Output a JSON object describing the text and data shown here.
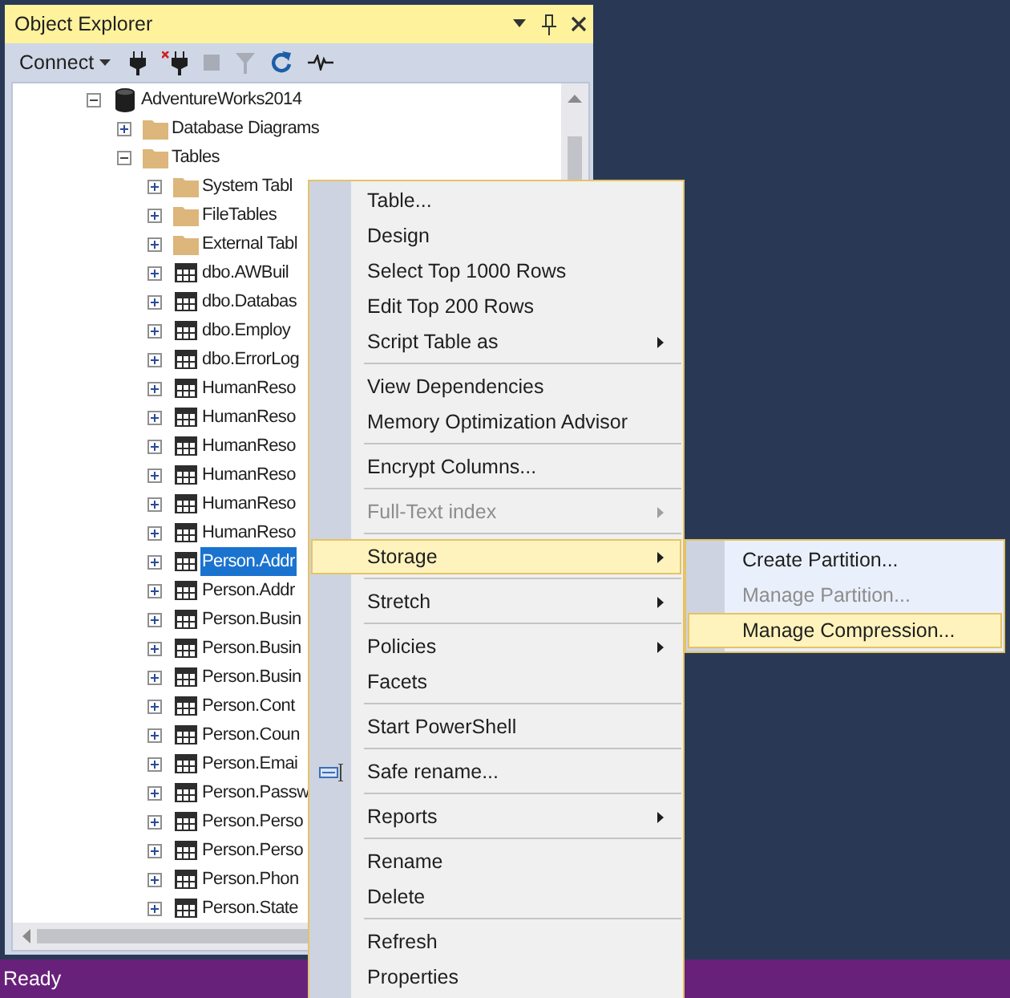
{
  "panel": {
    "title": "Object Explorer",
    "connect_label": "Connect"
  },
  "tree": [
    {
      "label": "AdventureWorks2014",
      "kind": "database",
      "expanded": true,
      "selected": false,
      "children": [
        {
          "label": "Database Diagrams",
          "kind": "folder",
          "expanded": false,
          "selected": false
        },
        {
          "label": "Tables",
          "kind": "folder",
          "expanded": true,
          "selected": false,
          "children": [
            {
              "label": "System Tabl",
              "kind": "folder",
              "expanded": false,
              "selected": false
            },
            {
              "label": "FileTables",
              "kind": "folder",
              "expanded": false,
              "selected": false
            },
            {
              "label": "External Tabl",
              "kind": "folder",
              "expanded": false,
              "selected": false
            },
            {
              "label": "dbo.AWBuil",
              "kind": "table",
              "expanded": false,
              "selected": false
            },
            {
              "label": "dbo.Databas",
              "kind": "table",
              "expanded": false,
              "selected": false
            },
            {
              "label": "dbo.Employ",
              "kind": "table",
              "expanded": false,
              "selected": false
            },
            {
              "label": "dbo.ErrorLog",
              "kind": "table",
              "expanded": false,
              "selected": false
            },
            {
              "label": "HumanReso",
              "kind": "table",
              "expanded": false,
              "selected": false
            },
            {
              "label": "HumanReso",
              "kind": "table",
              "expanded": false,
              "selected": false
            },
            {
              "label": "HumanReso",
              "kind": "table",
              "expanded": false,
              "selected": false
            },
            {
              "label": "HumanReso",
              "kind": "table",
              "expanded": false,
              "selected": false
            },
            {
              "label": "HumanReso",
              "kind": "table",
              "expanded": false,
              "selected": false
            },
            {
              "label": "HumanReso",
              "kind": "table",
              "expanded": false,
              "selected": false
            },
            {
              "label": "Person.Addr",
              "kind": "table",
              "expanded": false,
              "selected": true
            },
            {
              "label": "Person.Addr",
              "kind": "table",
              "expanded": false,
              "selected": false
            },
            {
              "label": "Person.Busin",
              "kind": "table",
              "expanded": false,
              "selected": false
            },
            {
              "label": "Person.Busin",
              "kind": "table",
              "expanded": false,
              "selected": false
            },
            {
              "label": "Person.Busin",
              "kind": "table",
              "expanded": false,
              "selected": false
            },
            {
              "label": "Person.Cont",
              "kind": "table",
              "expanded": false,
              "selected": false
            },
            {
              "label": "Person.Coun",
              "kind": "table",
              "expanded": false,
              "selected": false
            },
            {
              "label": "Person.Emai",
              "kind": "table",
              "expanded": false,
              "selected": false
            },
            {
              "label": "Person.Passw",
              "kind": "table",
              "expanded": false,
              "selected": false
            },
            {
              "label": "Person.Perso",
              "kind": "table",
              "expanded": false,
              "selected": false
            },
            {
              "label": "Person.Perso",
              "kind": "table",
              "expanded": false,
              "selected": false
            },
            {
              "label": "Person.Phon",
              "kind": "table",
              "expanded": false,
              "selected": false
            },
            {
              "label": "Person.State",
              "kind": "table",
              "expanded": false,
              "selected": false
            }
          ]
        }
      ]
    }
  ],
  "context_menu": {
    "items": [
      {
        "kind": "item",
        "label": "Table...",
        "submenu": false,
        "disabled": false,
        "selected": false
      },
      {
        "kind": "item",
        "label": "Design",
        "submenu": false,
        "disabled": false,
        "selected": false
      },
      {
        "kind": "item",
        "label": "Select Top 1000 Rows",
        "submenu": false,
        "disabled": false,
        "selected": false
      },
      {
        "kind": "item",
        "label": "Edit Top 200 Rows",
        "submenu": false,
        "disabled": false,
        "selected": false
      },
      {
        "kind": "item",
        "label": "Script Table as",
        "submenu": true,
        "disabled": false,
        "selected": false
      },
      {
        "kind": "separator"
      },
      {
        "kind": "item",
        "label": "View Dependencies",
        "submenu": false,
        "disabled": false,
        "selected": false
      },
      {
        "kind": "item",
        "label": "Memory Optimization Advisor",
        "submenu": false,
        "disabled": false,
        "selected": false
      },
      {
        "kind": "separator"
      },
      {
        "kind": "item",
        "label": "Encrypt Columns...",
        "submenu": false,
        "disabled": false,
        "selected": false
      },
      {
        "kind": "separator"
      },
      {
        "kind": "item",
        "label": "Full-Text index",
        "submenu": true,
        "disabled": true,
        "selected": false
      },
      {
        "kind": "separator"
      },
      {
        "kind": "item",
        "label": "Storage",
        "submenu": true,
        "disabled": false,
        "selected": true
      },
      {
        "kind": "separator"
      },
      {
        "kind": "item",
        "label": "Stretch",
        "submenu": true,
        "disabled": false,
        "selected": false
      },
      {
        "kind": "separator"
      },
      {
        "kind": "item",
        "label": "Policies",
        "submenu": true,
        "disabled": false,
        "selected": false
      },
      {
        "kind": "item",
        "label": "Facets",
        "submenu": false,
        "disabled": false,
        "selected": false
      },
      {
        "kind": "separator"
      },
      {
        "kind": "item",
        "label": "Start PowerShell",
        "submenu": false,
        "disabled": false,
        "selected": false
      },
      {
        "kind": "separator"
      },
      {
        "kind": "item",
        "label": "Safe rename...",
        "submenu": false,
        "disabled": false,
        "selected": false,
        "has_icon": true
      },
      {
        "kind": "separator"
      },
      {
        "kind": "item",
        "label": "Reports",
        "submenu": true,
        "disabled": false,
        "selected": false
      },
      {
        "kind": "separator"
      },
      {
        "kind": "item",
        "label": "Rename",
        "submenu": false,
        "disabled": false,
        "selected": false
      },
      {
        "kind": "item",
        "label": "Delete",
        "submenu": false,
        "disabled": false,
        "selected": false
      },
      {
        "kind": "separator"
      },
      {
        "kind": "item",
        "label": "Refresh",
        "submenu": false,
        "disabled": false,
        "selected": false
      },
      {
        "kind": "item",
        "label": "Properties",
        "submenu": false,
        "disabled": false,
        "selected": false
      }
    ]
  },
  "submenu": {
    "items": [
      {
        "label": "Create Partition...",
        "disabled": false,
        "selected": false
      },
      {
        "label": "Manage Partition...",
        "disabled": true,
        "selected": false
      },
      {
        "label": "Manage Compression...",
        "disabled": false,
        "selected": true
      }
    ]
  },
  "status_bar": {
    "text": "Ready"
  }
}
